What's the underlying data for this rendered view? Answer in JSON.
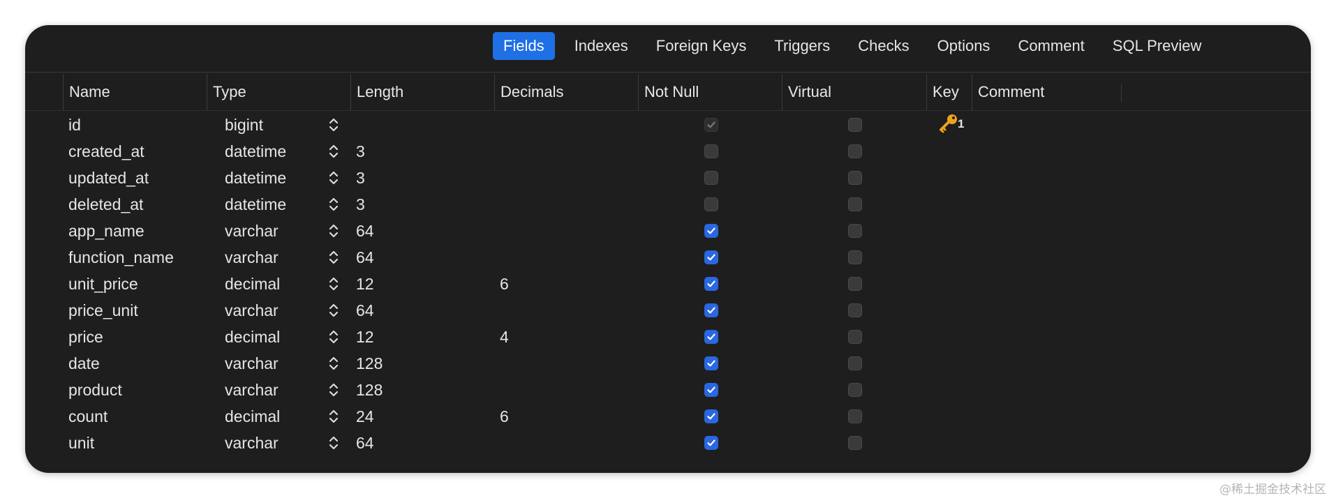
{
  "tabs": [
    {
      "label": "Fields",
      "active": true
    },
    {
      "label": "Indexes",
      "active": false
    },
    {
      "label": "Foreign Keys",
      "active": false
    },
    {
      "label": "Triggers",
      "active": false
    },
    {
      "label": "Checks",
      "active": false
    },
    {
      "label": "Options",
      "active": false
    },
    {
      "label": "Comment",
      "active": false
    },
    {
      "label": "SQL Preview",
      "active": false
    }
  ],
  "columns": [
    "Name",
    "Type",
    "Length",
    "Decimals",
    "Not Null",
    "Virtual",
    "Key",
    "Comment"
  ],
  "rows": [
    {
      "name": "id",
      "type": "bigint",
      "length": "",
      "decimals": "",
      "not_null": true,
      "not_null_disabled": true,
      "virtual": false,
      "key": "1"
    },
    {
      "name": "created_at",
      "type": "datetime",
      "length": "3",
      "decimals": "",
      "not_null": false,
      "virtual": false,
      "key": ""
    },
    {
      "name": "updated_at",
      "type": "datetime",
      "length": "3",
      "decimals": "",
      "not_null": false,
      "virtual": false,
      "key": ""
    },
    {
      "name": "deleted_at",
      "type": "datetime",
      "length": "3",
      "decimals": "",
      "not_null": false,
      "virtual": false,
      "key": ""
    },
    {
      "name": "app_name",
      "type": "varchar",
      "length": "64",
      "decimals": "",
      "not_null": true,
      "virtual": false,
      "key": ""
    },
    {
      "name": "function_name",
      "type": "varchar",
      "length": "64",
      "decimals": "",
      "not_null": true,
      "virtual": false,
      "key": ""
    },
    {
      "name": "unit_price",
      "type": "decimal",
      "length": "12",
      "decimals": "6",
      "not_null": true,
      "virtual": false,
      "key": ""
    },
    {
      "name": "price_unit",
      "type": "varchar",
      "length": "64",
      "decimals": "",
      "not_null": true,
      "virtual": false,
      "key": ""
    },
    {
      "name": "price",
      "type": "decimal",
      "length": "12",
      "decimals": "4",
      "not_null": true,
      "virtual": false,
      "key": ""
    },
    {
      "name": "date",
      "type": "varchar",
      "length": "128",
      "decimals": "",
      "not_null": true,
      "virtual": false,
      "key": ""
    },
    {
      "name": "product",
      "type": "varchar",
      "length": "128",
      "decimals": "",
      "not_null": true,
      "virtual": false,
      "key": ""
    },
    {
      "name": "count",
      "type": "decimal",
      "length": "24",
      "decimals": "6",
      "not_null": true,
      "virtual": false,
      "key": ""
    },
    {
      "name": "unit",
      "type": "varchar",
      "length": "64",
      "decimals": "",
      "not_null": true,
      "virtual": false,
      "key": ""
    }
  ],
  "watermark": "@稀土掘金技术社区",
  "colors": {
    "background": "#1e1e1e",
    "accent": "#1f6fe5",
    "checkbox_on": "#2a67e0",
    "key_icon": "#f0a11c"
  },
  "icons": {
    "stepper": "chevron-up-down-icon",
    "key": "key-icon",
    "check": "checkmark-icon"
  }
}
